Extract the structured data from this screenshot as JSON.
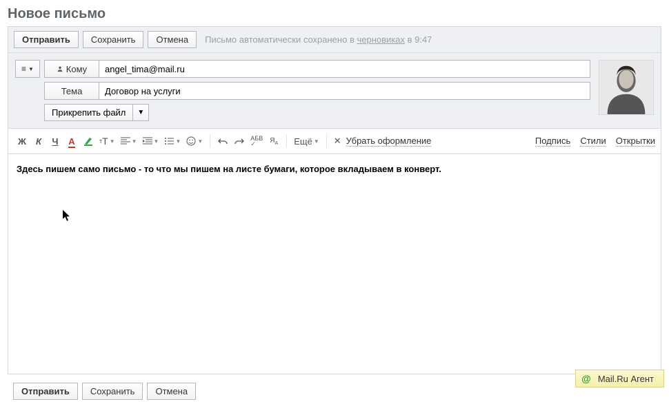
{
  "title": "Новое письмо",
  "actions": {
    "send": "Отправить",
    "save": "Сохранить",
    "cancel": "Отмена"
  },
  "autosave": {
    "prefix": "Письмо автоматически сохранено в ",
    "link": "черновиках",
    "suffix": " в 9:47"
  },
  "fields": {
    "to_label": "Кому",
    "to_value": "angel_tima@mail.ru",
    "subject_label": "Тема",
    "subject_value": "Договор на услуги",
    "attach": "Прикрепить файл"
  },
  "toolbar": {
    "bold": "Ж",
    "italic": "К",
    "underline": "Ч",
    "font_size": "тТ",
    "more": "Ещё",
    "strip": "Убрать оформление",
    "signature": "Подпись",
    "styles": "Стили",
    "cards": "Открытки",
    "spell": "АБВ"
  },
  "body": "Здесь пишем само письмо - то что мы пишем на листе бумаги, которое вкладываем в конверт.",
  "agent": {
    "label": "Mail.Ru Агент"
  }
}
